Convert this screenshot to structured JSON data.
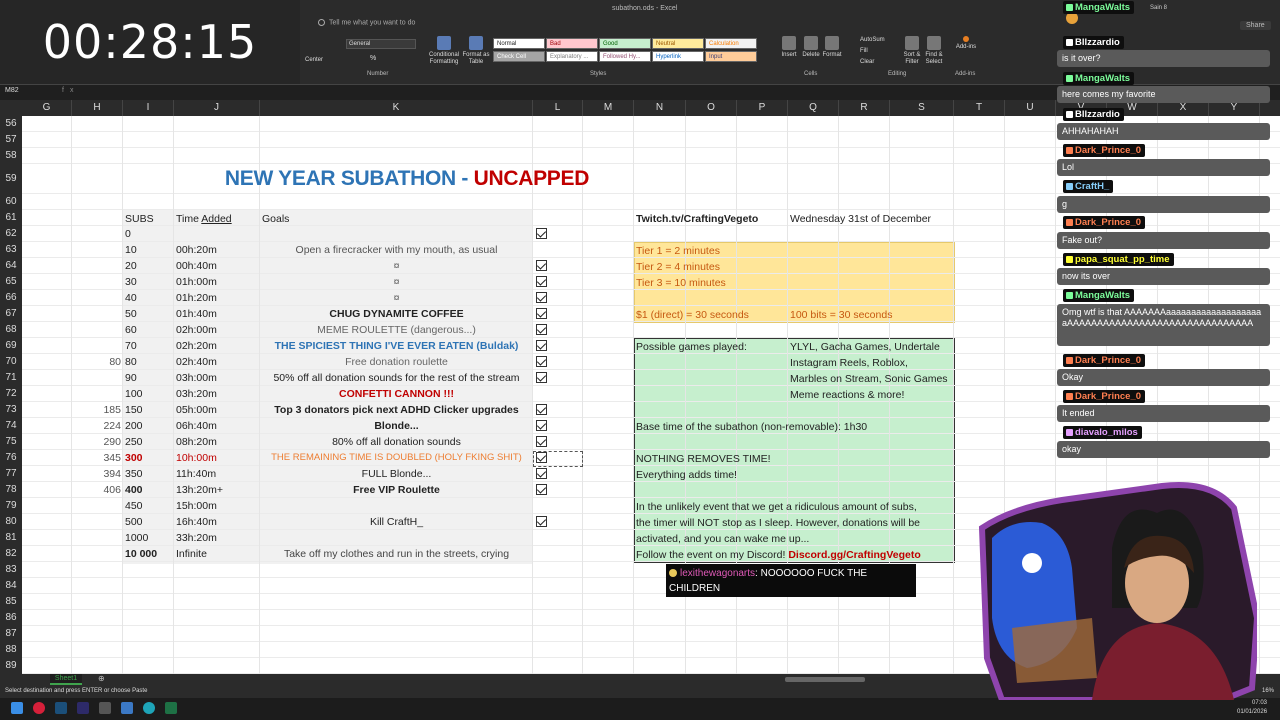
{
  "timer": "00:28:15",
  "excel": {
    "doc_title": "subathon.ods - Excel",
    "tell_me": "Tell me what you want to do",
    "name_box": "M82",
    "fx": "fx",
    "ribbon": {
      "alignment": {
        "center": "Center"
      },
      "number": {
        "format": "General",
        "label": "Number",
        "pct": "%",
        "comma": "9"
      },
      "styles": {
        "conditional": "Conditional Formatting",
        "format_table": "Format as Table",
        "cells": [
          "Normal",
          "Bad",
          "Good",
          "Neutral",
          "Calculation",
          "Check Cell",
          "Explanatory ...",
          "Followed Hy...",
          "Hyperlink",
          "Input"
        ],
        "label": "Styles"
      },
      "cells": {
        "insert": "Insert",
        "delete": "Delete",
        "format": "Format",
        "label": "Cells"
      },
      "editing": {
        "autosum": "AutoSum",
        "fill": "Fill",
        "clear": "Clear",
        "sort": "Sort & Filter",
        "find": "Find & Select",
        "label": "Editing"
      },
      "addins": {
        "addins": "Add-ins",
        "label": "Add-ins"
      },
      "share": "Share"
    },
    "columns": [
      "G",
      "H",
      "I",
      "J",
      "K",
      "L",
      "M",
      "N",
      "O",
      "P",
      "Q",
      "R",
      "S",
      "T",
      "U",
      "V",
      "W",
      "X",
      "Y"
    ],
    "rows": [
      "56",
      "57",
      "58",
      "59",
      "60",
      "61",
      "62",
      "63",
      "64",
      "65",
      "66",
      "67",
      "68",
      "69",
      "70",
      "71",
      "72",
      "73",
      "74",
      "75",
      "76",
      "77",
      "78",
      "79",
      "80",
      "81",
      "82",
      "83",
      "84",
      "85",
      "86",
      "87",
      "88",
      "89"
    ],
    "title_a": "NEW YEAR SUBATHON - ",
    "title_b": "UNCAPPED",
    "headers": {
      "subs": "SUBS",
      "time": "Time ",
      "time_u": "Added",
      "goals": "Goals"
    },
    "table": [
      {
        "h": "",
        "subs": "0",
        "time": "",
        "goal": ""
      },
      {
        "h": "",
        "subs": "10",
        "time": "00h:20m",
        "goal": "Open a firecracker with my mouth, as usual"
      },
      {
        "h": "",
        "subs": "20",
        "time": "00h:40m",
        "goal": "¤"
      },
      {
        "h": "",
        "subs": "30",
        "time": "01h:00m",
        "goal": "¤"
      },
      {
        "h": "",
        "subs": "40",
        "time": "01h:20m",
        "goal": "¤"
      },
      {
        "h": "",
        "subs": "50",
        "time": "01h:40m",
        "goal": "CHUG DYNAMITE COFFEE"
      },
      {
        "h": "",
        "subs": "60",
        "time": "02h:00m",
        "goal": "MEME ROULETTE (dangerous...)"
      },
      {
        "h": "",
        "subs": "70",
        "time": "02h:20m",
        "goal": "THE SPICIEST THING I'VE EVER EATEN (Buldak)"
      },
      {
        "h": "80",
        "subs": "80",
        "time": "02h:40m",
        "goal": "Free donation roulette"
      },
      {
        "h": "",
        "subs": "90",
        "time": "03h:00m",
        "goal": "50% off all donation sounds for the rest of the stream"
      },
      {
        "h": "",
        "subs": "100",
        "time": "03h:20m",
        "goal": "CONFETTI CANNON !!!"
      },
      {
        "h": "185",
        "subs": "150",
        "time": "05h:00m",
        "goal": "Top 3 donators pick next ADHD Clicker upgrades"
      },
      {
        "h": "224",
        "subs": "200",
        "time": "06h:40m",
        "goal": "Blonde..."
      },
      {
        "h": "290",
        "subs": "250",
        "time": "08h:20m",
        "goal": "80% off all donation sounds"
      },
      {
        "h": "345",
        "subs": "300",
        "time": "10h:00m",
        "goal": "THE REMAINING TIME IS DOUBLED (HOLY FKING SHIT)"
      },
      {
        "h": "394",
        "subs": "350",
        "time": "11h:40m",
        "goal": "FULL Blonde..."
      },
      {
        "h": "406",
        "subs": "400",
        "time": "13h:20m+",
        "goal": "Free VIP Roulette"
      },
      {
        "h": "",
        "subs": "450",
        "time": "15h:00m",
        "goal": ""
      },
      {
        "h": "",
        "subs": "500",
        "time": "16h:40m",
        "goal": "Kill CraftH_"
      },
      {
        "h": "",
        "subs": "1000",
        "time": "33h:20m",
        "goal": ""
      },
      {
        "h": "",
        "subs": "10 000",
        "time": "Infinite",
        "goal": "Take off my clothes and run in the streets, crying"
      }
    ],
    "checks": [
      0,
      2,
      3,
      4,
      5,
      6,
      7,
      8,
      9,
      11,
      12,
      13,
      14,
      15,
      16,
      18
    ],
    "info": {
      "twitch": "Twitch.tv/CraftingVegeto",
      "date": "Wednesday 31st of December",
      "tier1": "Tier 1 = 2 minutes",
      "tier2": "Tier 2 = 4 minutes",
      "tier3": "Tier 3 = 10 minutes",
      "direct": "$1 (direct) = 30 seconds",
      "bits": "100 bits =  30 seconds",
      "games_label": "Possible games played:",
      "games1": "YLYL, Gacha Games, Undertale",
      "games2": "Instagram Reels, Roblox,",
      "games3": "Marbles on Stream, Sonic Games",
      "games4": "Meme reactions & more!",
      "base": "Base time of the subathon (non-removable): 1h30",
      "nothing": "NOTHING REMOVES TIME!",
      "everything": "Everything adds time!",
      "unlikely1": "In the unlikely event that we get a ridiculous amount of subs,",
      "unlikely2": "the timer will NOT stop as I sleep. However, donations will be",
      "unlikely3": "activated, and you can wake me up...",
      "follow": "Follow the event on my Discord!  ",
      "discord": "Discord.gg/CraftingVegeto"
    },
    "sheet_tab": "Sheet1",
    "status": "Select destination and press ENTER or choose Paste",
    "zoom": "16%",
    "clock_time": "07:03",
    "clock_date": "01/01/2026"
  },
  "popup": {
    "user": "lexithewagonarts",
    "text": ": NOOOOOO FUCK THE CHILDREN"
  },
  "chat": [
    {
      "name": "MangaWalts",
      "color": "#7CFC9A",
      "msg": ""
    },
    {
      "name": "Bllzzardio",
      "color": "#ffffff",
      "msg": "is it over?"
    },
    {
      "name": "MangaWalts",
      "color": "#7CFC9A",
      "msg": "here comes my favorite"
    },
    {
      "name": "Bllzzardio",
      "color": "#ffffff",
      "msg": "AHHAHAHAH"
    },
    {
      "name": "Dark_Prince_0",
      "color": "#FF7F50",
      "msg": "Lol"
    },
    {
      "name": "CraftH_",
      "color": "#87CEFA",
      "msg": "g"
    },
    {
      "name": "Dark_Prince_0",
      "color": "#FF7F50",
      "msg": "Fake out?"
    },
    {
      "name": "papa_squat_pp_time",
      "color": "#FFFF33",
      "msg": "now its over"
    },
    {
      "name": "MangaWalts",
      "color": "#7CFC9A",
      "msg": "Omg wtf is that AAAAAAAaaaaaaaaaaaaaaaaaaaaAAAAAAAAAAAAAAAAAAAAAAAAAAAAAAA"
    },
    {
      "name": "Dark_Prince_0",
      "color": "#FF7F50",
      "msg": "Okay"
    },
    {
      "name": "Dark_Prince_0",
      "color": "#FF7F50",
      "msg": "It ended"
    },
    {
      "name": "diavalo_milos",
      "color": "#E6A0FF",
      "msg": "okay"
    }
  ],
  "chat_top_extra": "Sain 8"
}
